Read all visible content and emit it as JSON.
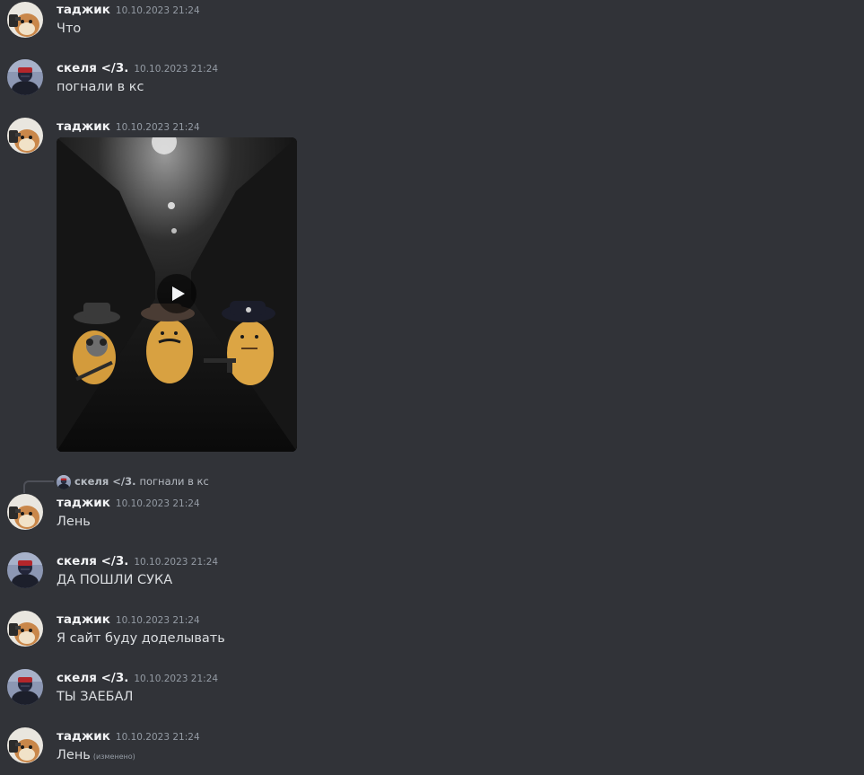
{
  "users": {
    "tadzhik": {
      "name": "таджик"
    },
    "skelya": {
      "name": "скеля </3."
    }
  },
  "messages": [
    {
      "author": "таджик",
      "timestamp": "10.10.2023 21:24",
      "text": "Что"
    },
    {
      "author": "скеля </3.",
      "timestamp": "10.10.2023 21:24",
      "text": "погнали в кс"
    },
    {
      "author": "таджик",
      "timestamp": "10.10.2023 21:24",
      "text": "",
      "attachment": {
        "type": "video",
        "icon": "play-icon"
      }
    },
    {
      "author": "таджик",
      "timestamp": "10.10.2023 21:24",
      "text": "Лень",
      "reply_to": {
        "author": "скеля </3.",
        "text": "погнали в кс"
      }
    },
    {
      "author": "скеля </3.",
      "timestamp": "10.10.2023 21:24",
      "text": "ДА ПОШЛИ СУКА"
    },
    {
      "author": "таджик",
      "timestamp": "10.10.2023 21:24",
      "text": "Я сайт буду доделывать"
    },
    {
      "author": "скеля </3.",
      "timestamp": "10.10.2023 21:24",
      "text": "ТЫ ЗАЕБАЛ"
    },
    {
      "author": "таджик",
      "timestamp": "10.10.2023 21:24",
      "text": "Лень",
      "edited_label": "(изменено)"
    }
  ],
  "colors": {
    "background": "#313338",
    "author": "#f2f3f5",
    "timestamp": "#949ba4",
    "text": "#dbdee1"
  }
}
